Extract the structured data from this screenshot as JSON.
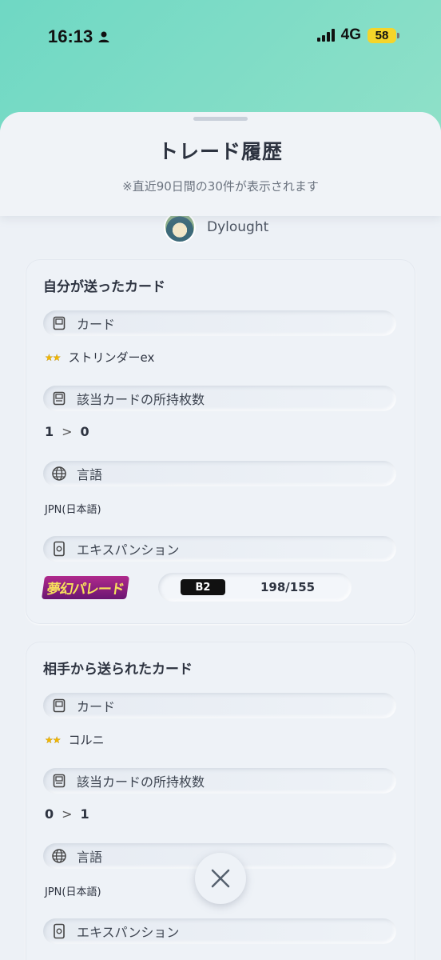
{
  "status_bar": {
    "time": "16:13",
    "network": "4G",
    "battery": "58"
  },
  "sheet": {
    "title": "トレード履歴",
    "subtitle": "※直近90日間の30件が表示されます"
  },
  "user": {
    "name": "Dylought"
  },
  "sent": {
    "section_title": "自分が送ったカード",
    "card_label": "カード",
    "card_rarity": "★★",
    "card_name": "ストリンダーex",
    "count_label": "該当カードの所持枚数",
    "count_from": "1",
    "count_arrow": ">",
    "count_to": "0",
    "language_label": "言語",
    "language_value": "JPN(日本語)",
    "expansion_label": "エキスパンション",
    "expansion_logo": "夢幻パレード",
    "set_code": "B2",
    "set_number": "198/155"
  },
  "received": {
    "section_title": "相手から送られたカード",
    "card_label": "カード",
    "card_rarity": "★★",
    "card_name": "コルニ",
    "count_label": "該当カードの所持枚数",
    "count_from": "0",
    "count_arrow": ">",
    "count_to": "1",
    "language_label": "言語",
    "language_value": "JPN(日本語)",
    "expansion_label": "エキスパンション"
  },
  "icons": {
    "card": "card-icon",
    "count": "card-stack-icon",
    "language": "globe-icon",
    "expansion": "expansion-pack-icon",
    "close": "close-icon"
  },
  "colors": {
    "background_gradient_start": "#6fd8c4",
    "sheet_bg": "#edf1f6",
    "star": "#f2b600",
    "set_code_bg": "#111111",
    "battery": "#f5d52a"
  }
}
